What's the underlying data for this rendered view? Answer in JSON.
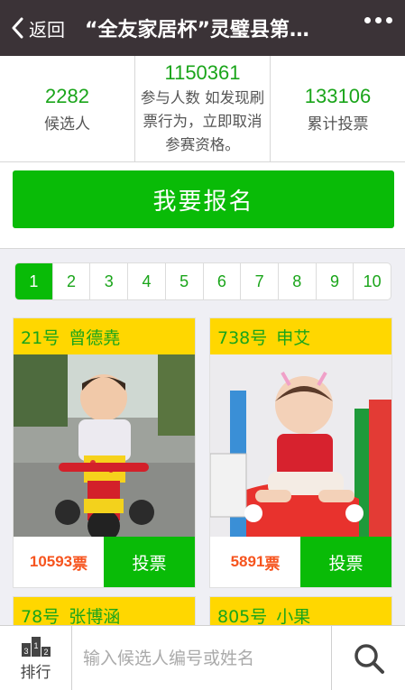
{
  "header": {
    "back_label": "返回",
    "title": "“全友家居杯”灵璧县第…",
    "more_icon": "more-dots-icon"
  },
  "stats": {
    "candidates": {
      "value": "2282",
      "label": "候选人"
    },
    "participants": {
      "value": "1150361",
      "note": "参与人数 如发现刷票行为，立即取消参赛资格。"
    },
    "total_votes": {
      "value": "133106",
      "label": "累计投票"
    }
  },
  "signup_label": "我要报名",
  "pagination": {
    "pages": [
      "1",
      "2",
      "3",
      "4",
      "5",
      "6",
      "7",
      "8",
      "9",
      "10"
    ],
    "active": "1"
  },
  "cards": [
    {
      "number": "21号",
      "name": "曾德堯",
      "votes": "10593",
      "votes_unit": "票",
      "vote_label": "投票"
    },
    {
      "number": "738号",
      "name": "申艾",
      "votes": "5891",
      "votes_unit": "票",
      "vote_label": "投票"
    },
    {
      "number": "78号",
      "name": "张博涵"
    },
    {
      "number": "805号",
      "name": "小果"
    }
  ],
  "bottom": {
    "rank_label": "排行",
    "rank_icon_text": "312",
    "search_placeholder": "输入候选人编号或姓名",
    "search_icon": "search-icon"
  },
  "colors": {
    "accent": "#09bb07",
    "header_bg": "#3b3337",
    "card_head": "#ffd700",
    "votes": "#f6541e"
  }
}
